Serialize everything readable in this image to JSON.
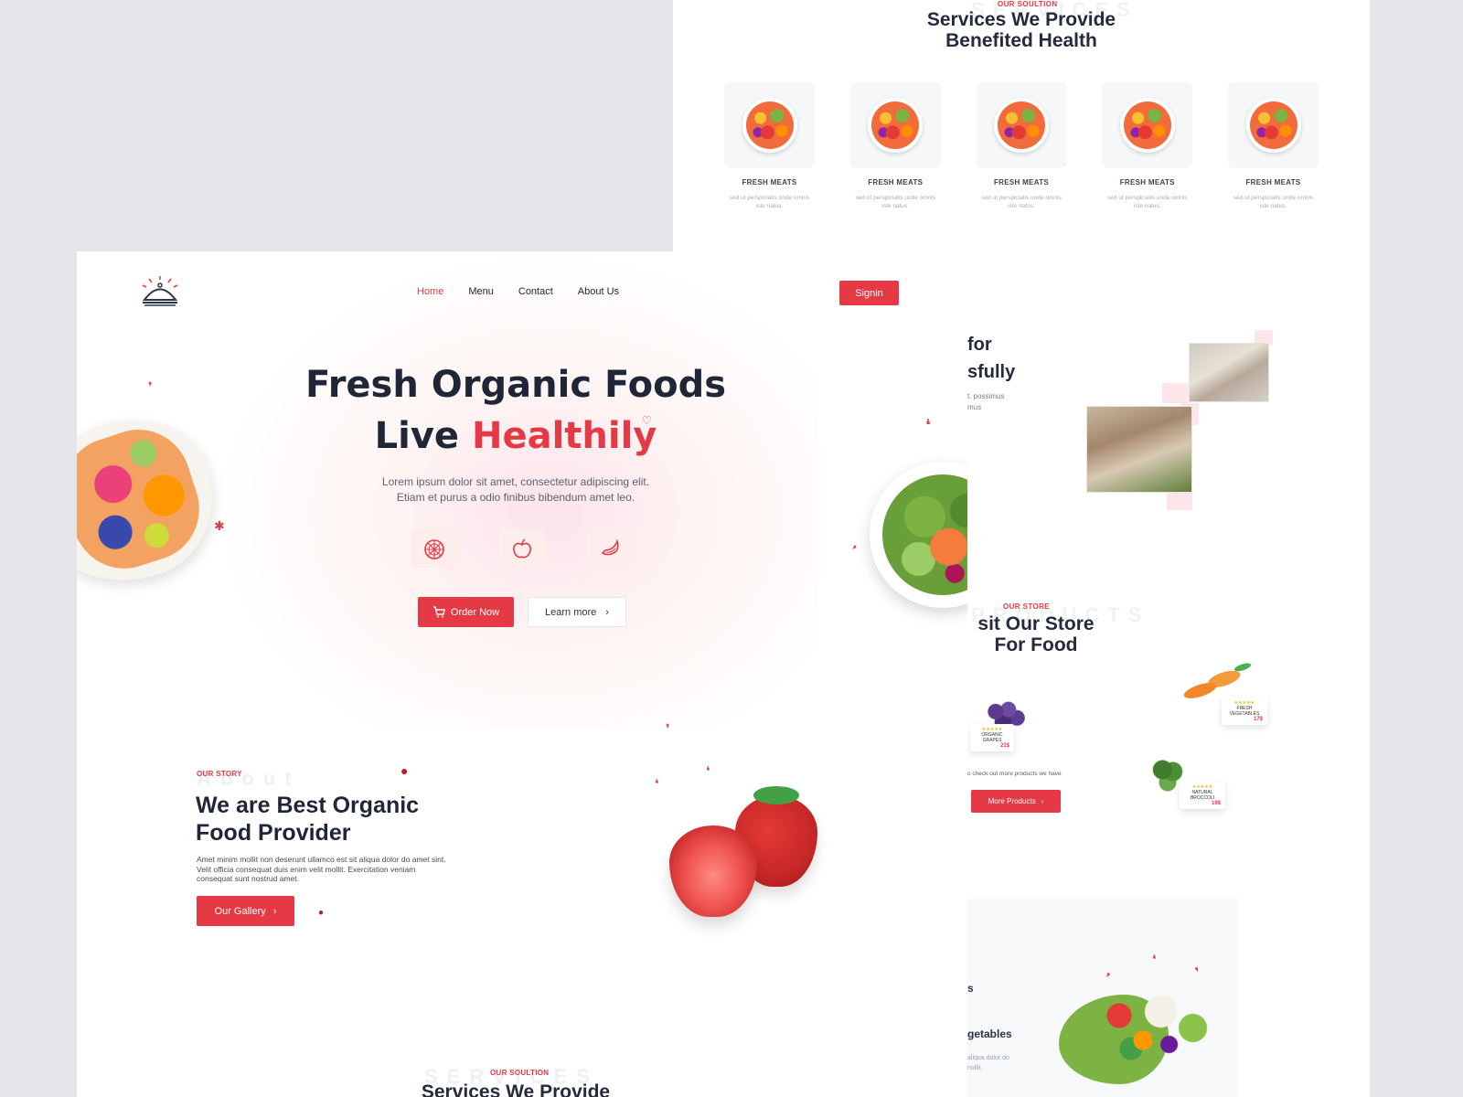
{
  "colors": {
    "accent": "#e63946",
    "heading": "#1f2637",
    "background": "#e5e6ea"
  },
  "back_page": {
    "services": {
      "eyebrow": "OUR SOULTION",
      "watermark": "SERVICES",
      "title_line1": "Services We Provide",
      "title_line2": "Benefited Health",
      "cards": [
        {
          "title": "FRESH MEATS",
          "desc": "sed ut perspiciatis unde omnis iste natus.",
          "icon": "fruit-bowl"
        },
        {
          "title": "FRESH MEATS",
          "desc": "sed ut perspiciatis unde omnis iste natus.",
          "icon": "fruit-bowl"
        },
        {
          "title": "FRESH MEATS",
          "desc": "sed ut perspiciatis unde omnis iste natus.",
          "icon": "fruit-bowl"
        },
        {
          "title": "FRESH MEATS",
          "desc": "sed ut perspiciatis unde omnis iste natus.",
          "icon": "fruit-bowl"
        },
        {
          "title": "FRESH MEATS",
          "desc": "sed ut perspiciatis unde omnis iste natus.",
          "icon": "fruit-bowl"
        }
      ]
    },
    "about": {
      "line1": "for",
      "line2": "sfully",
      "small1": "t. possimus",
      "small2": "mus"
    },
    "store": {
      "eyebrow": "OUR STORE",
      "watermark": "PRODUCTS",
      "title_line1": "sit Our Store",
      "title_line2": "For Food",
      "check_text": "o check out more products we have",
      "button": "More Products",
      "products": [
        {
          "name": "ORGANIC GRAPES",
          "price": "21$",
          "stars": "★★★★★"
        },
        {
          "name": "FRESH VEGETABLES",
          "price": "17$",
          "stars": "★★★★★"
        },
        {
          "name": "NATURAL BROCCOLI",
          "price": "19$",
          "stars": "★★★★★"
        }
      ]
    },
    "vegetables": {
      "heading_fragment": "s",
      "title": "getables",
      "desc1": "aliqua dolor do",
      "desc2": "nollit."
    }
  },
  "front_page": {
    "nav": {
      "home": "Home",
      "menu": "Menu",
      "contact": "Contact",
      "about": "About Us",
      "signin": "Signin"
    },
    "hero": {
      "title_line1": "Fresh Organic Foods",
      "title_line2_a": "Live",
      "title_line2_b": "Healthily",
      "desc_line1": "Lorem ipsum dolor sit amet, consectetur adipiscing elit.",
      "desc_line2": "Etiam et purus a odio finibus bibendum amet leo.",
      "icons": [
        "orange-slice-icon",
        "apple-icon",
        "banana-icon"
      ],
      "order_button": "Order Now",
      "learn_button": "Learn more"
    },
    "story": {
      "eyebrow": "OUR STORY",
      "watermark": "About",
      "title_line1": "We are Best Organic",
      "title_line2": "Food Provider",
      "desc": "Amet minim mollit non deserunt ullamco est sit aliqua dolor do amet sint. Velit officia consequat duis enim velit mollit. Exercitation veniam consequat sunt nostrud amet.",
      "button": "Our Gallery"
    },
    "services_preview": {
      "eyebrow": "OUR SOULTION",
      "watermark": "SERVICES",
      "title": "Services We Provide"
    }
  }
}
